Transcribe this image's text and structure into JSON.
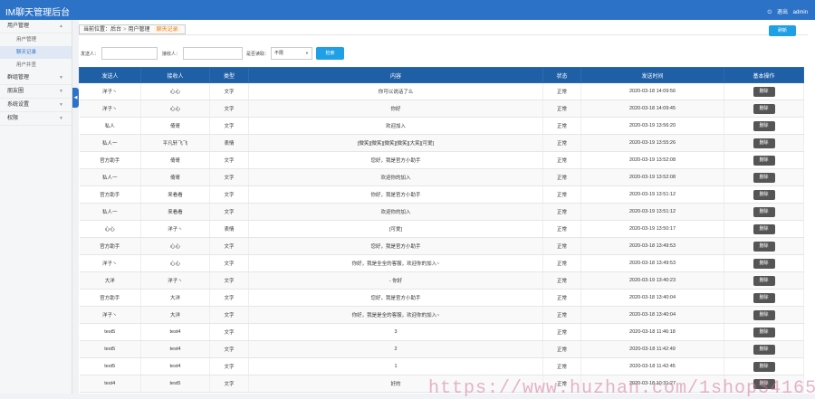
{
  "header": {
    "title": "IM聊天管理后台",
    "logout_label": "退出",
    "username": "admin"
  },
  "sidebar": {
    "groups": [
      {
        "label": "用户管理",
        "expanded": true,
        "items": [
          {
            "label": "用户管理",
            "active": false
          },
          {
            "label": "聊天记录",
            "active": true
          },
          {
            "label": "用户并查",
            "active": false
          }
        ]
      },
      {
        "label": "群组管理",
        "expanded": false
      },
      {
        "label": "朋友圈",
        "expanded": false
      },
      {
        "label": "系统设置",
        "expanded": false
      },
      {
        "label": "权限",
        "expanded": false
      }
    ]
  },
  "breadcrumb": {
    "prefix": "当前位置：",
    "home": "后台",
    "section": "用户管理",
    "current": "聊天记录"
  },
  "refresh_label": "刷新",
  "filter": {
    "sender_label": "发送人：",
    "sender_value": "",
    "receiver_label": "接收人：",
    "receiver_value": "",
    "status_label": "是否读取：",
    "status_value": "不限",
    "submit_label": "检索"
  },
  "table": {
    "headers": [
      "发送人",
      "接收人",
      "类型",
      "内容",
      "状态",
      "发送时间",
      "基本操作"
    ],
    "action_label": "删除",
    "rows": [
      [
        "洋子丶",
        "心心",
        "文字",
        "你可以说话了么",
        "正常",
        "2020-03-18 14:09:56"
      ],
      [
        "洋子丶",
        "心心",
        "文字",
        "你好",
        "正常",
        "2020-03-18 14:09:45"
      ],
      [
        "私人",
        "倚哥",
        "文字",
        "欢迎加入",
        "正常",
        "2020-03-19 13:56:20"
      ],
      [
        "私人一",
        "平凡轩飞飞",
        "表情",
        "[微笑][微笑][微笑][微笑][大笑][可爱]",
        "正常",
        "2020-03-19 13:55:26"
      ],
      [
        "官方助手",
        "倚哥",
        "文字",
        "您好，我是官方小助手",
        "正常",
        "2020-03-19 13:52:08"
      ],
      [
        "私人一",
        "倚哥",
        "文字",
        "欢迎你的加入",
        "正常",
        "2020-03-19 13:52:08"
      ],
      [
        "官方助手",
        "来看看",
        "文字",
        "你好，我是官方小助手",
        "正常",
        "2020-03-19 13:51:12"
      ],
      [
        "私人一",
        "来看看",
        "文字",
        "欢迎你的加入",
        "正常",
        "2020-03-19 13:51:12"
      ],
      [
        "心心",
        "洋子丶",
        "表情",
        "[可爱]",
        "正常",
        "2020-03-19 13:50:17"
      ],
      [
        "官方助手",
        "心心",
        "文字",
        "您好，我是官方小助手",
        "正常",
        "2020-03-18 13:49:53"
      ],
      [
        "洋子丶",
        "心心",
        "文字",
        "你好，我是全全的客服，欢迎你的加入~",
        "正常",
        "2020-03-18 13:49:53"
      ],
      [
        "大洋",
        "洋子丶",
        "文字",
        "- 你好",
        "正常",
        "2020-03-19 13:40:23"
      ],
      [
        "官方助手",
        "大洋",
        "文字",
        "您好，我是官方小助手",
        "正常",
        "2020-03-18 13:40:04"
      ],
      [
        "洋子丶",
        "大洋",
        "文字",
        "你好，我是是全的客服，欢迎你的加入~",
        "正常",
        "2020-03-18 13:40:04"
      ],
      [
        "test5",
        "test4",
        "文字",
        "3",
        "正常",
        "2020-03-18 11:46:18"
      ],
      [
        "test5",
        "test4",
        "文字",
        "2",
        "正常",
        "2020-03-18 11:42:49"
      ],
      [
        "test5",
        "test4",
        "文字",
        "1",
        "正常",
        "2020-03-18 11:42:45"
      ],
      [
        "test4",
        "test5",
        "文字",
        "好的",
        "正常",
        "2020-03-18 10:31:27"
      ]
    ]
  },
  "watermark": "https://www.huzhan.com/1shop34165"
}
